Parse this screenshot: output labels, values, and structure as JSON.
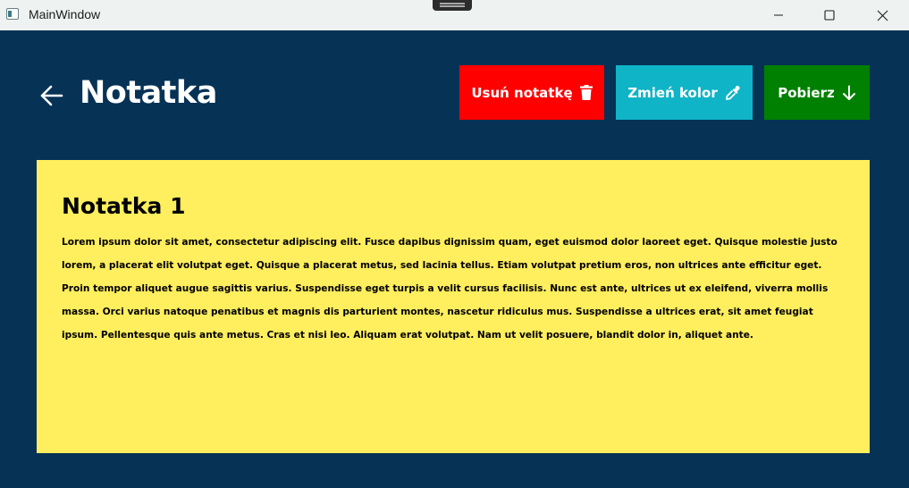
{
  "window": {
    "title": "MainWindow"
  },
  "header": {
    "title": "Notatka",
    "back_icon": "arrow-left-icon",
    "buttons": {
      "delete": {
        "label": "Usuń notatkę",
        "icon": "trash-icon",
        "color": "#ff0000"
      },
      "change_color": {
        "label": "Zmień kolor",
        "icon": "eyedropper-icon",
        "color": "#0fb4c6"
      },
      "download": {
        "label": "Pobierz",
        "icon": "arrow-down-icon",
        "color": "#008000"
      }
    }
  },
  "note": {
    "title": "Notatka 1",
    "body": "Lorem ipsum dolor sit amet, consectetur adipiscing elit. Fusce dapibus dignissim quam, eget euismod dolor laoreet eget. Quisque molestie justo lorem, a placerat elit volutpat eget. Quisque a placerat metus, sed lacinia tellus. Etiam volutpat pretium eros, non ultrices ante efficitur eget. Proin tempor aliquet augue sagittis varius. Suspendisse eget turpis a velit cursus facilisis. Nunc est ante, ultrices ut ex eleifend, viverra mollis massa. Orci varius natoque penatibus et magnis dis parturient montes, nascetur ridiculus mus. Suspendisse a ultrices erat, sit amet feugiat ipsum. Pellentesque quis ante metus. Cras et nisi leo. Aliquam erat volutpat. Nam ut velit posuere, blandit dolor in, aliquet ante.",
    "background_color": "#ffee5d"
  },
  "colors": {
    "window_background": "#063256",
    "titlebar_background": "#eef3f1"
  }
}
